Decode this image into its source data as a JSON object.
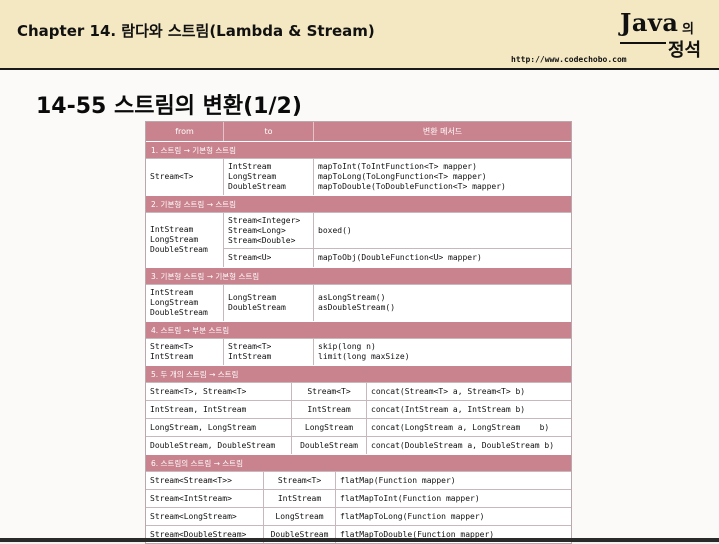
{
  "header": {
    "chapter": "Chapter 14. 람다와 스트림(Lambda & Stream)",
    "logo_java": "Java",
    "logo_ui": "의",
    "logo_jeongseok": "정석",
    "url": "http://www.codechobo.com"
  },
  "title": "14-55 스트림의 변환(1/2)",
  "table": {
    "headers": {
      "from": "from",
      "to": "to",
      "example": "변환 메서드"
    },
    "sections": [
      {
        "label": "1. 스트림 → 기본형 스트림",
        "from": "Stream<T>",
        "to": [
          "IntStream",
          "LongStream",
          "DoubleStream"
        ],
        "methods": [
          "mapToInt(ToIntFunction<T> mapper)",
          "mapToLong(ToLongFunction<T> mapper)",
          "mapToDouble(ToDoubleFunction<T> mapper)"
        ]
      },
      {
        "label": "2. 기본형 스트림 → 스트림",
        "from": [
          "IntStream",
          "LongStream",
          "DoubleStream"
        ],
        "rows": [
          {
            "to": [
              "Stream<Integer>",
              "Stream<Long>",
              "Stream<Double>"
            ],
            "method": "boxed()"
          },
          {
            "to": [
              "Stream<U>"
            ],
            "method": "mapToObj(DoubleFunction<U> mapper)"
          }
        ]
      },
      {
        "label": "3. 기본형 스트림 → 기본형 스트림",
        "from": [
          "IntStream",
          "LongStream",
          "DoubleStream"
        ],
        "to": [
          "LongStream",
          "DoubleStream"
        ],
        "methods": [
          "asLongStream()",
          "asDoubleStream()"
        ]
      },
      {
        "label": "4. 스트림 → 부분 스트림",
        "from": [
          "Stream<T>",
          "IntStream"
        ],
        "to": [
          "Stream<T>",
          "IntStream"
        ],
        "methods": [
          "skip(long n)",
          "limit(long maxSize)"
        ]
      },
      {
        "label": "5. 두 개의 스트림 → 스트림",
        "rows": [
          {
            "from": "Stream<T>, Stream<T>",
            "to": "Stream<T>",
            "method": "concat(Stream<T> a, Stream<T> b)"
          },
          {
            "from": "IntStream, IntStream",
            "to": "IntStream",
            "method": "concat(IntStream a, IntStream b)"
          },
          {
            "from": "LongStream, LongStream",
            "to": "LongStream",
            "method": "concat(LongStream a, LongStream    b)"
          },
          {
            "from": "DoubleStream, DoubleStream",
            "to": "DoubleStream",
            "method": "concat(DoubleStream a, DoubleStream b)"
          }
        ]
      },
      {
        "label": "6. 스트림의 스트림 → 스트림",
        "rows": [
          {
            "from": "Stream<Stream<T>>",
            "to": "Stream<T>",
            "method": "flatMap(Function mapper)"
          },
          {
            "from": "Stream<IntStream>",
            "to": "IntStream",
            "method": "flatMapToInt(Function mapper)"
          },
          {
            "from": "Stream<LongStream>",
            "to": "LongStream",
            "method": "flatMapToLong(Function mapper)"
          },
          {
            "from": "Stream<DoubleStream>",
            "to": "DoubleStream",
            "method": "flatMapToDouble(Function mapper)"
          }
        ]
      }
    ]
  }
}
